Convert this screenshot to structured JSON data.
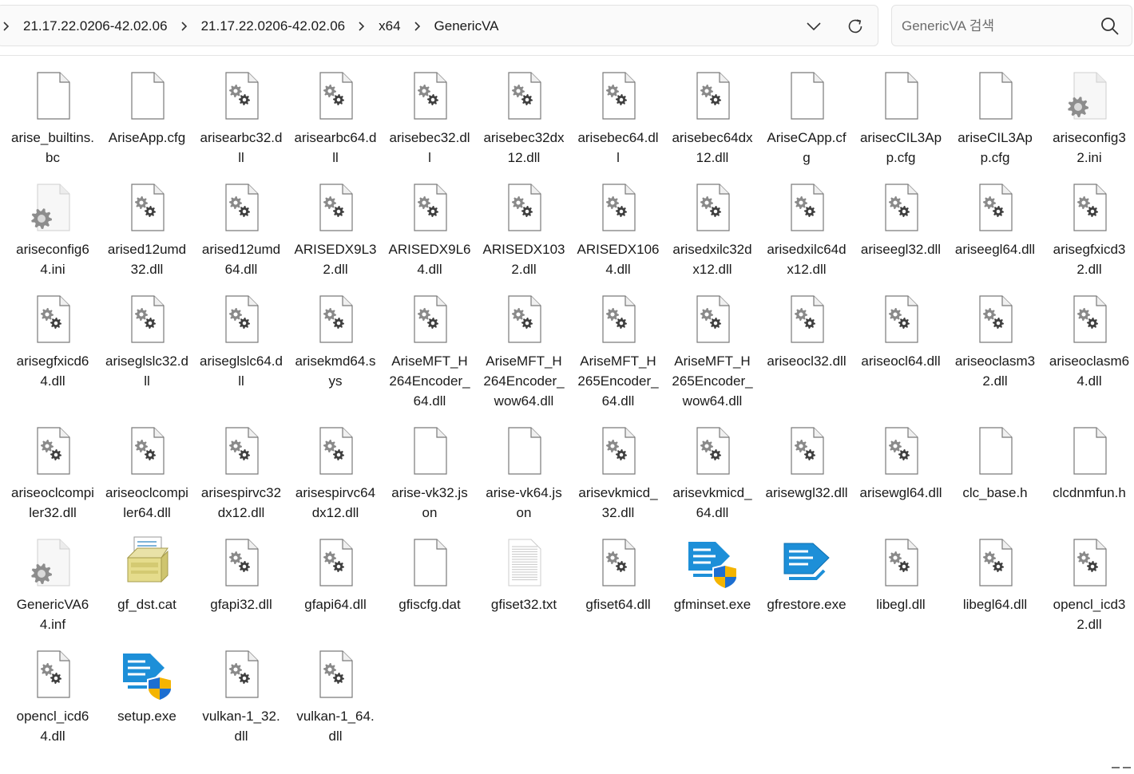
{
  "address": {
    "breadcrumbs": [
      "21.17.22.0206-42.02.06",
      "21.17.22.0206-42.02.06",
      "x64",
      "GenericVA"
    ]
  },
  "search": {
    "placeholder": "GenericVA 검색"
  },
  "files": [
    {
      "name": "arise_builtins.bc",
      "icon": "blank-file-icon"
    },
    {
      "name": "AriseApp.cfg",
      "icon": "blank-file-icon"
    },
    {
      "name": "arisearbc32.dll",
      "icon": "dll-file-icon"
    },
    {
      "name": "arisearbc64.dll",
      "icon": "dll-file-icon"
    },
    {
      "name": "arisebec32.dll",
      "icon": "dll-file-icon"
    },
    {
      "name": "arisebec32dx12.dll",
      "icon": "dll-file-icon"
    },
    {
      "name": "arisebec64.dll",
      "icon": "dll-file-icon"
    },
    {
      "name": "arisebec64dx12.dll",
      "icon": "dll-file-icon"
    },
    {
      "name": "AriseCApp.cfg",
      "icon": "blank-file-icon"
    },
    {
      "name": "arisecCIL3App.cfg",
      "icon": "blank-file-icon"
    },
    {
      "name": "ariseCIL3App.cfg",
      "icon": "blank-file-icon"
    },
    {
      "name": "ariseconfig32.ini",
      "icon": "settings-file-icon"
    },
    {
      "name": "ariseconfig64.ini",
      "icon": "settings-file-icon"
    },
    {
      "name": "arised12umd32.dll",
      "icon": "dll-file-icon"
    },
    {
      "name": "arised12umd64.dll",
      "icon": "dll-file-icon"
    },
    {
      "name": "ARISEDX9L32.dll",
      "icon": "dll-file-icon"
    },
    {
      "name": "ARISEDX9L64.dll",
      "icon": "dll-file-icon"
    },
    {
      "name": "ARISEDX1032.dll",
      "icon": "dll-file-icon"
    },
    {
      "name": "ARISEDX1064.dll",
      "icon": "dll-file-icon"
    },
    {
      "name": "arisedxilc32dx12.dll",
      "icon": "dll-file-icon"
    },
    {
      "name": "arisedxilc64dx12.dll",
      "icon": "dll-file-icon"
    },
    {
      "name": "ariseegl32.dll",
      "icon": "dll-file-icon"
    },
    {
      "name": "ariseegl64.dll",
      "icon": "dll-file-icon"
    },
    {
      "name": "arisegfxicd32.dll",
      "icon": "dll-file-icon"
    },
    {
      "name": "arisegfxicd64.dll",
      "icon": "dll-file-icon"
    },
    {
      "name": "ariseglslc32.dll",
      "icon": "dll-file-icon"
    },
    {
      "name": "ariseglslc64.dll",
      "icon": "dll-file-icon"
    },
    {
      "name": "arisekmd64.sys",
      "icon": "dll-file-icon"
    },
    {
      "name": "AriseMFT_H264Encoder_64.dll",
      "icon": "dll-file-icon"
    },
    {
      "name": "AriseMFT_H264Encoder_wow64.dll",
      "icon": "dll-file-icon"
    },
    {
      "name": "AriseMFT_H265Encoder_64.dll",
      "icon": "dll-file-icon"
    },
    {
      "name": "AriseMFT_H265Encoder_wow64.dll",
      "icon": "dll-file-icon"
    },
    {
      "name": "ariseocl32.dll",
      "icon": "dll-file-icon"
    },
    {
      "name": "ariseocl64.dll",
      "icon": "dll-file-icon"
    },
    {
      "name": "ariseoclasm32.dll",
      "icon": "dll-file-icon"
    },
    {
      "name": "ariseoclasm64.dll",
      "icon": "dll-file-icon"
    },
    {
      "name": "ariseoclcompiler32.dll",
      "icon": "dll-file-icon"
    },
    {
      "name": "ariseoclcompiler64.dll",
      "icon": "dll-file-icon"
    },
    {
      "name": "arisespirvc32dx12.dll",
      "icon": "dll-file-icon"
    },
    {
      "name": "arisespirvc64dx12.dll",
      "icon": "dll-file-icon"
    },
    {
      "name": "arise-vk32.json",
      "icon": "blank-file-icon"
    },
    {
      "name": "arise-vk64.json",
      "icon": "blank-file-icon"
    },
    {
      "name": "arisevkmicd_32.dll",
      "icon": "dll-file-icon"
    },
    {
      "name": "arisevkmicd_64.dll",
      "icon": "dll-file-icon"
    },
    {
      "name": "arisewgl32.dll",
      "icon": "dll-file-icon"
    },
    {
      "name": "arisewgl64.dll",
      "icon": "dll-file-icon"
    },
    {
      "name": "clc_base.h",
      "icon": "blank-file-icon"
    },
    {
      "name": "clcdnmfun.h",
      "icon": "blank-file-icon"
    },
    {
      "name": "GenericVA64.inf",
      "icon": "settings-file-icon"
    },
    {
      "name": "gf_dst.cat",
      "icon": "catalog-file-icon"
    },
    {
      "name": "gfapi32.dll",
      "icon": "dll-file-icon"
    },
    {
      "name": "gfapi64.dll",
      "icon": "dll-file-icon"
    },
    {
      "name": "gfiscfg.dat",
      "icon": "blank-file-icon"
    },
    {
      "name": "gfiset32.txt",
      "icon": "text-file-icon"
    },
    {
      "name": "gfiset64.dll",
      "icon": "dll-file-icon"
    },
    {
      "name": "gfminset.exe",
      "icon": "installer-shield-icon"
    },
    {
      "name": "gfrestore.exe",
      "icon": "installer-icon"
    },
    {
      "name": "libegl.dll",
      "icon": "dll-file-icon"
    },
    {
      "name": "libegl64.dll",
      "icon": "dll-file-icon"
    },
    {
      "name": "opencl_icd32.dll",
      "icon": "dll-file-icon"
    },
    {
      "name": "opencl_icd64.dll",
      "icon": "dll-file-icon"
    },
    {
      "name": "setup.exe",
      "icon": "installer-shield-icon"
    },
    {
      "name": "vulkan-1_32.dll",
      "icon": "dll-file-icon"
    },
    {
      "name": "vulkan-1_64.dll",
      "icon": "dll-file-icon"
    }
  ]
}
